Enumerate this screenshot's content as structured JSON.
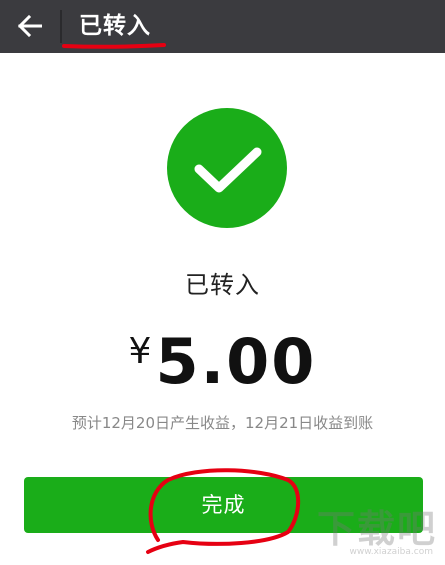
{
  "header": {
    "title": "已转入",
    "back_icon": "arrow-left-icon",
    "background_color": "#3b3b3f"
  },
  "result": {
    "status_icon": "checkmark-icon",
    "status_text": "已转入",
    "currency_symbol": "¥",
    "amount": "5.00",
    "note": "预计12月20日产生收益，12月21日收益到账",
    "accent_color": "#1aad19"
  },
  "actions": {
    "done_label": "完成"
  },
  "annotations": {
    "highlight_color": "#e60012"
  },
  "watermark": {
    "text": "下载吧",
    "url": "www.xiazaiba.com"
  }
}
